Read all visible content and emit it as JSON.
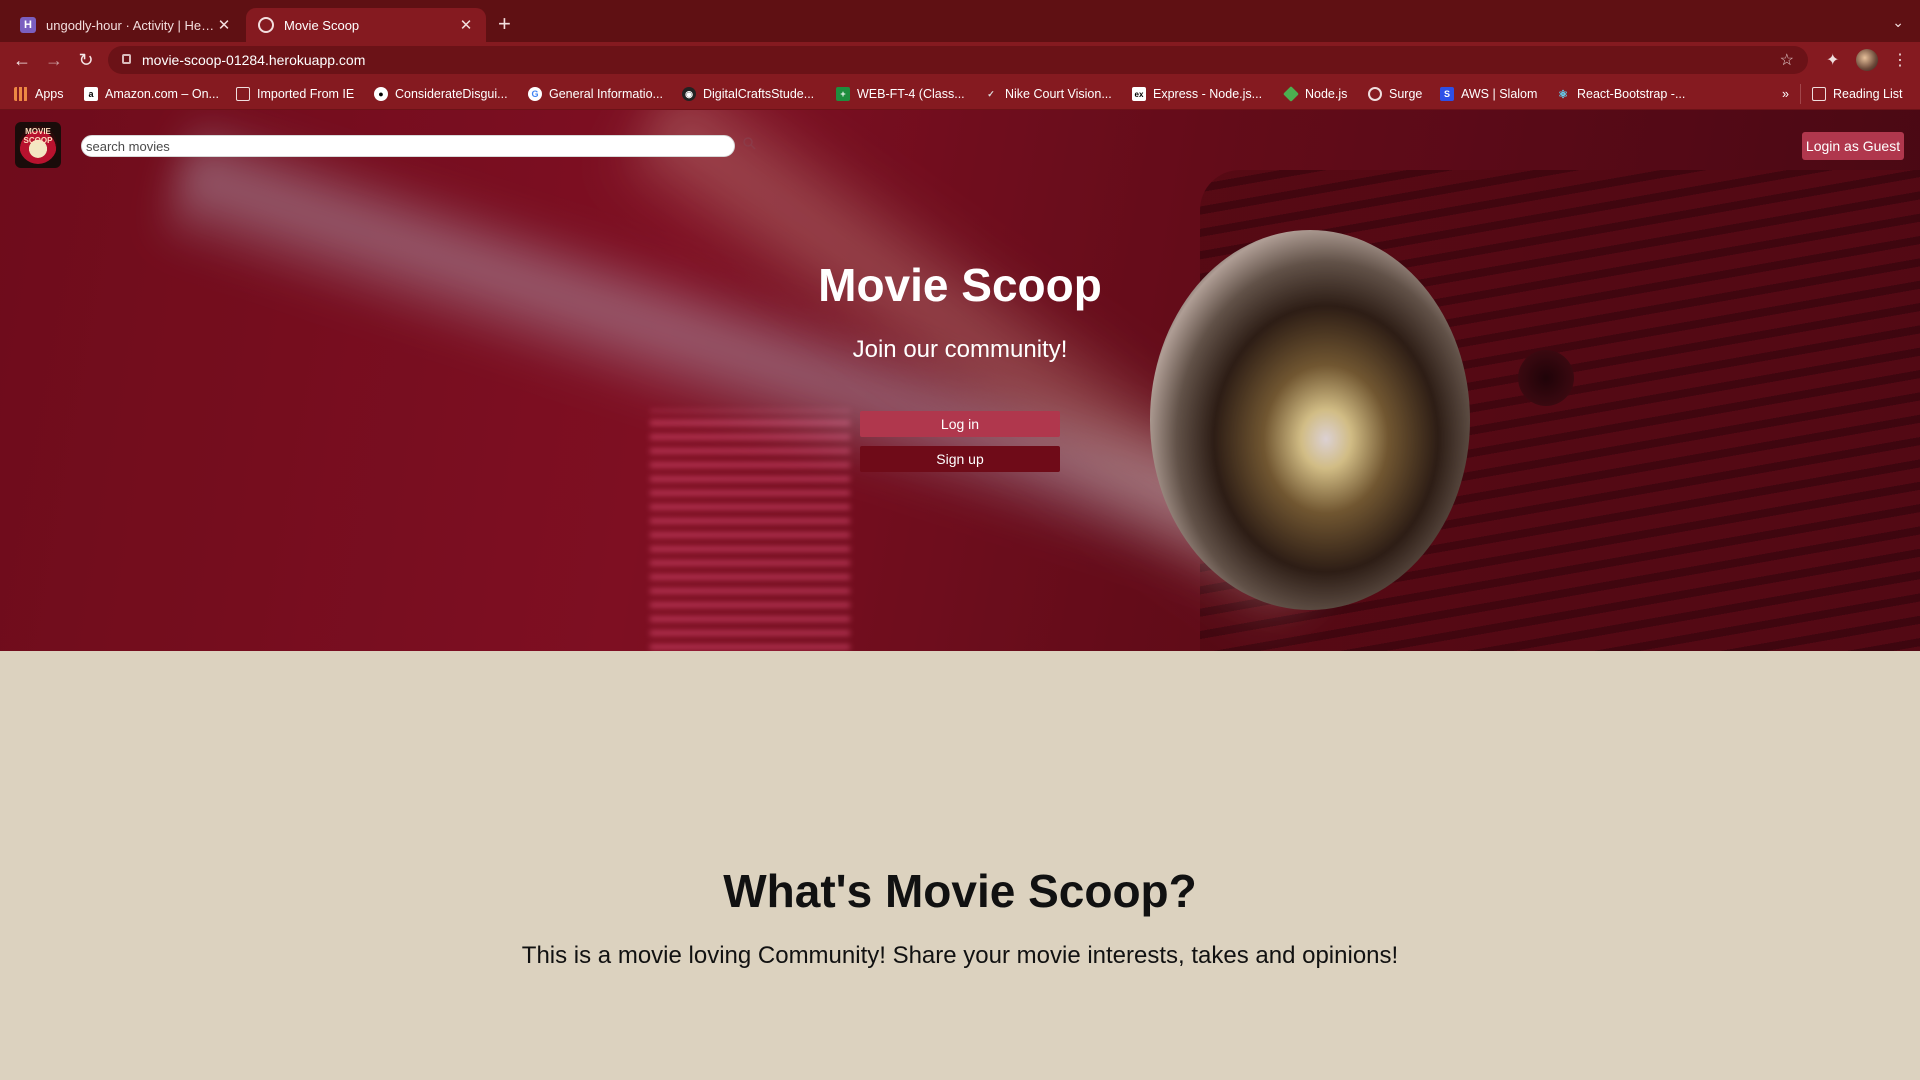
{
  "browser": {
    "tabs": [
      {
        "title": "ungodly-hour · Activity | Herok",
        "favicon": "heroku-icon",
        "active": false
      },
      {
        "title": "Movie Scoop",
        "favicon": "globe-icon",
        "active": true
      }
    ],
    "url": "movie-scoop-01284.herokuapp.com",
    "bookmarks": [
      {
        "label": "Apps",
        "icon": "apps-grid-icon"
      },
      {
        "label": "Amazon.com – On...",
        "icon": "amazon-icon"
      },
      {
        "label": "Imported From IE",
        "icon": "folder-icon"
      },
      {
        "label": "ConsiderateDisgui...",
        "icon": "site-icon"
      },
      {
        "label": "General Informatio...",
        "icon": "google-icon"
      },
      {
        "label": "DigitalCraftsStude...",
        "icon": "github-icon"
      },
      {
        "label": "WEB-FT-4 (Class...",
        "icon": "sheets-icon"
      },
      {
        "label": "Nike Court Vision...",
        "icon": "nike-icon"
      },
      {
        "label": "Express - Node.js...",
        "icon": "express-icon"
      },
      {
        "label": "Node.js",
        "icon": "nodejs-icon"
      },
      {
        "label": "Surge",
        "icon": "globe-icon"
      },
      {
        "label": "AWS | Slalom",
        "icon": "slalom-icon"
      },
      {
        "label": "React-Bootstrap -...",
        "icon": "react-bootstrap-icon"
      }
    ],
    "overflow_label": "»",
    "reading_list": "Reading List"
  },
  "site": {
    "logo_text": "MOVIE SCOOP",
    "search": {
      "placeholder": "search movies",
      "value": ""
    },
    "guest_button": "Login as Guest",
    "hero": {
      "title": "Movie Scoop",
      "subtitle": "Join our community!",
      "login_button": "Log in",
      "signup_button": "Sign up"
    },
    "about": {
      "title": "What's Movie Scoop?",
      "text": "This is a movie loving Community! Share your movie interests, takes and opinions!"
    }
  },
  "colors": {
    "tabstrip": "#5f1013",
    "toolbar": "#851a20",
    "accent_button": "#b0374d",
    "dark_button": "#6f0b18",
    "section_bg": "#dcd2bf"
  }
}
